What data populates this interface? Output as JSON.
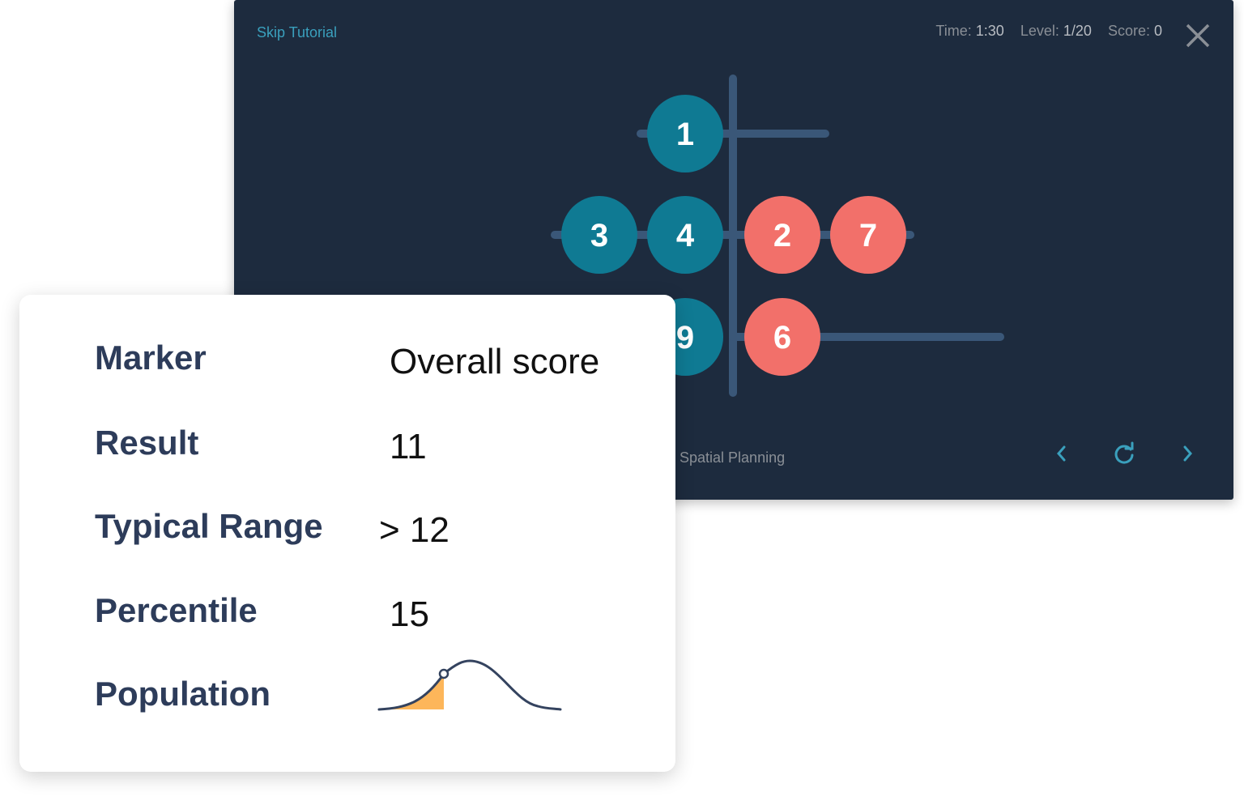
{
  "game": {
    "skip_label": "Skip Tutorial",
    "stats": {
      "time_label": "Time:",
      "time": "1:30",
      "level_label": "Level:",
      "level": "1/20",
      "score_label": "Score:",
      "score": "0"
    },
    "name": "Spatial Planning",
    "colors": {
      "background": "#1d2b3e",
      "teal": "#0f7a93",
      "coral": "#f2706a",
      "track": "#3a5778",
      "accent": "#3aa0bd"
    },
    "balls": [
      {
        "label": "1",
        "color": "teal"
      },
      {
        "label": "3",
        "color": "teal"
      },
      {
        "label": "4",
        "color": "teal"
      },
      {
        "label": "2",
        "color": "coral"
      },
      {
        "label": "7",
        "color": "coral"
      },
      {
        "label": "9",
        "color": "teal"
      },
      {
        "label": "6",
        "color": "coral"
      }
    ]
  },
  "card": {
    "rows": [
      {
        "label": "Marker",
        "value": "Overall score"
      },
      {
        "label": "Result",
        "value": "11"
      },
      {
        "label": "Typical Range",
        "value": "> 12"
      },
      {
        "label": "Percentile",
        "value": "15"
      },
      {
        "label": "Population",
        "value": ""
      }
    ],
    "percentile": 15,
    "colors": {
      "fill": "#fdb65a",
      "line": "#34435f"
    }
  }
}
